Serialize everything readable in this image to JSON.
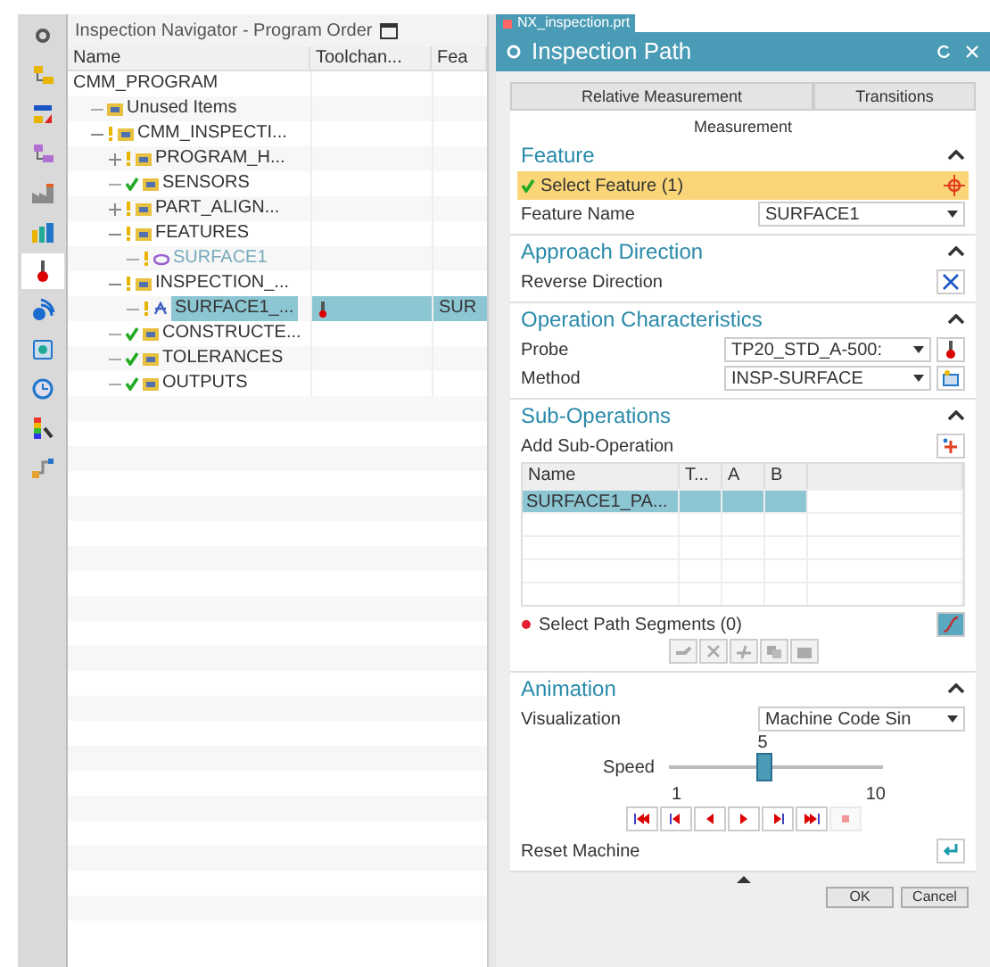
{
  "toolbar": [
    {
      "selected": false
    },
    {
      "selected": false
    },
    {
      "selected": false
    },
    {
      "selected": false
    },
    {
      "selected": false
    },
    {
      "selected": false
    },
    {
      "selected": true
    },
    {
      "selected": false
    },
    {
      "selected": false
    },
    {
      "selected": false
    },
    {
      "selected": false
    },
    {
      "selected": false
    }
  ],
  "navigator": {
    "title": "Inspection Navigator - Program Order",
    "columns": [
      "Name",
      "Toolchan...",
      "Fea"
    ],
    "tree": [
      {
        "name": "CMM_PROGRAM",
        "children": [
          {
            "name": "Unused Items"
          },
          {
            "name": "CMM_INSPECTI...",
            "complete": false,
            "expanded": true,
            "children": [
              {
                "name": "PROGRAM_H...",
                "complete": false,
                "expanded": false
              },
              {
                "name": "SENSORS",
                "complete": true
              },
              {
                "name": "PART_ALIGN...",
                "complete": false,
                "expanded": false
              },
              {
                "name": "FEATURES",
                "complete": false,
                "expanded": true,
                "children": [
                  {
                    "name": "SURFACE1",
                    "complete": false,
                    "kind": "feature"
                  }
                ]
              },
              {
                "name": "INSPECTION_...",
                "complete": false,
                "expanded": true,
                "children": [
                  {
                    "name": "SURFACE1_...",
                    "complete": false,
                    "kind": "path",
                    "selected": true,
                    "toolchange": true,
                    "feature": "SUR"
                  }
                ]
              },
              {
                "name": "CONSTRUCTE...",
                "complete": true
              },
              {
                "name": "TOLERANCES",
                "complete": true
              },
              {
                "name": "OUTPUTS",
                "complete": true
              }
            ]
          }
        ]
      }
    ]
  },
  "file_tab": {
    "title": "NX_inspection.prt"
  },
  "dialog": {
    "title": "Inspection Path",
    "tabs": [
      {
        "label": "Relative Measurement",
        "selected": false
      },
      {
        "label": "Transitions",
        "selected": false
      }
    ],
    "subtitle": "Measurement",
    "feature": {
      "heading": "Feature",
      "select_label": "Select Feature (1)",
      "name_label": "Feature Name",
      "name_value": "SURFACE1"
    },
    "approach": {
      "heading": "Approach Direction",
      "reverse_label": "Reverse Direction"
    },
    "operation": {
      "heading": "Operation Characteristics",
      "probe_label": "Probe",
      "probe_value": "TP20_STD_A-500:",
      "method_label": "Method",
      "method_value": "INSP-SURFACE"
    },
    "sub_operations": {
      "heading": "Sub-Operations",
      "add_label": "Add Sub-Operation",
      "columns": [
        "Name",
        "T...",
        "A",
        "B"
      ],
      "rows": [
        {
          "cells": [
            "SURFACE1_PA..."
          ],
          "selected": true
        }
      ],
      "segments_label": "Select Path Segments (0)"
    },
    "animation": {
      "heading": "Animation",
      "visualization_label": "Visualization",
      "visualization_value": "Machine Code Sin",
      "speed_label": "Speed",
      "speed_value": "5",
      "speed_min": "1",
      "speed_max": "10",
      "level": 0.444,
      "controls": [
        {
          "kind": "first",
          "disabled": false
        },
        {
          "kind": "step_back",
          "disabled": false
        },
        {
          "kind": "back",
          "disabled": false
        },
        {
          "kind": "play",
          "disabled": false
        },
        {
          "kind": "step_forward",
          "disabled": false
        },
        {
          "kind": "last",
          "disabled": false
        },
        {
          "kind": "stop",
          "disabled": true
        }
      ],
      "reset_label": "Reset Machine"
    },
    "buttons": [
      "OK",
      "Cancel"
    ]
  }
}
